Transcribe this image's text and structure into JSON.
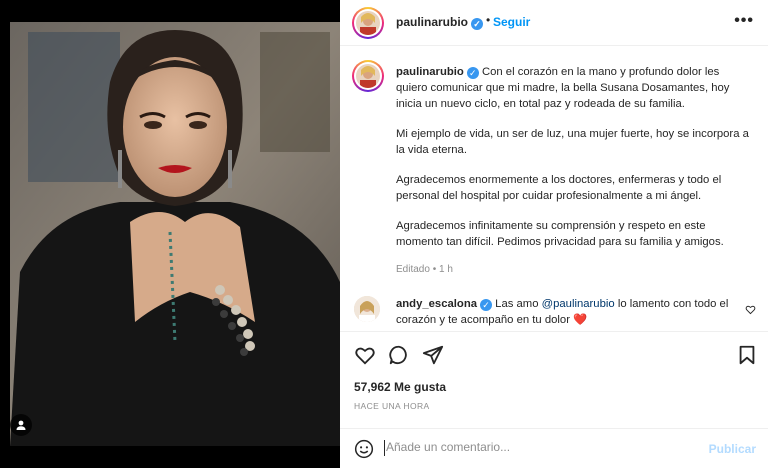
{
  "post": {
    "username": "paulinarubio",
    "verified": true,
    "follow_label": "Seguir",
    "separator": "•",
    "more_label": "•••"
  },
  "caption": {
    "username": "paulinarubio",
    "paragraphs": [
      "Con el corazón en la mano y profundo dolor les quiero comunicar que mi madre, la bella Susana Dosamantes, hoy inicia un nuevo ciclo, en total paz y rodeada de su familia.",
      "Mi ejemplo de vida, un ser de luz, una mujer fuerte, hoy se incorpora a la vida eterna.",
      "Agradecemos enormemente a los doctores, enfermeras y todo el personal del hospital por cuidar profesionalmente a mi ángel.",
      "Agradecemos infinitamente su comprensión y respeto en este momento tan difícil. Pedimos privacidad para su familia y amigos."
    ],
    "edited_label": "Editado",
    "edited_time": "1 h",
    "edited_dot": "•"
  },
  "comment": {
    "username": "andy_escalona",
    "verified": true,
    "text_before": "Las amo",
    "mention": "@paulinarubio",
    "text_after": "lo lamento con todo el corazón y te acompaño en tu dolor",
    "emoji": "❤️"
  },
  "engagement": {
    "likes": "57,962 Me gusta",
    "time_ago": "HACE UNA HORA"
  },
  "comment_box": {
    "placeholder": "Añade un comentario...",
    "publish_label": "Publicar"
  },
  "colors": {
    "accent": "#0095f6",
    "verified": "#3897f0",
    "publish_disabled": "#b3dbff",
    "heart_red": "#ed4956"
  },
  "icons": {
    "user_tag": "user-icon",
    "like": "heart-icon",
    "comment": "comment-icon",
    "share": "paper-plane-icon",
    "save": "bookmark-icon",
    "emoji": "emoji-icon",
    "comment_like": "heart-icon"
  }
}
